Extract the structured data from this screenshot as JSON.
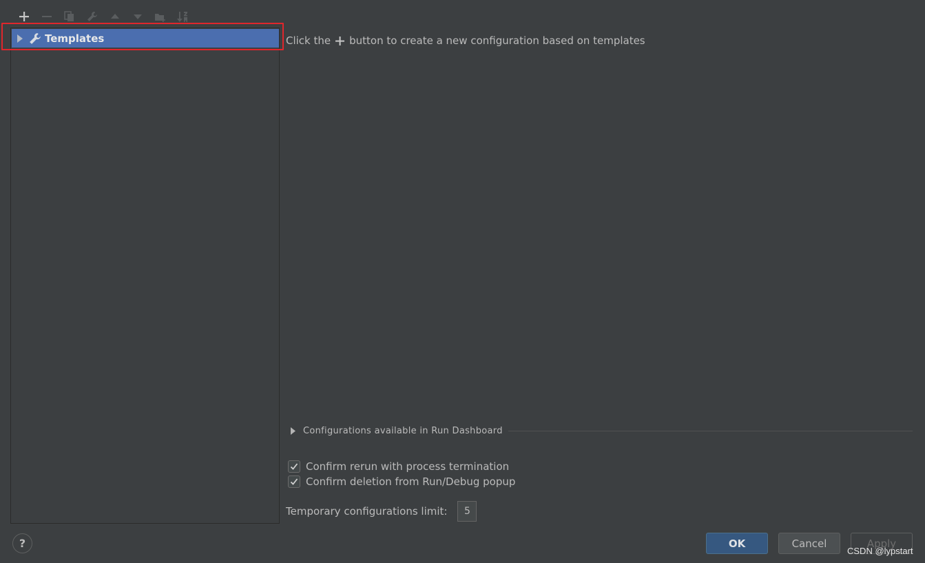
{
  "toolbar": {
    "items": [
      {
        "icon": "add-icon",
        "enabled": true
      },
      {
        "icon": "remove-icon",
        "enabled": false
      },
      {
        "icon": "copy-icon",
        "enabled": false
      },
      {
        "icon": "wrench-icon",
        "enabled": false
      },
      {
        "icon": "move-up-icon",
        "enabled": false
      },
      {
        "icon": "move-down-icon",
        "enabled": false
      },
      {
        "icon": "new-folder-icon",
        "enabled": false
      },
      {
        "icon": "sort-alphabetically-icon",
        "enabled": false
      }
    ]
  },
  "tree": {
    "items": [
      {
        "label": "Templates",
        "icon": "wrench-icon",
        "expanded": false,
        "selected": true
      }
    ],
    "highlight_color": "#e0262c",
    "selection_color": "#4b6eaf"
  },
  "main": {
    "hint_prefix": "Click the",
    "hint_suffix": "button to create a new configuration based on templates",
    "dashboard_label": "Configurations available in Run Dashboard",
    "options": [
      {
        "label": "Confirm rerun with process termination",
        "checked": true
      },
      {
        "label": "Confirm deletion from Run/Debug popup",
        "checked": true
      }
    ],
    "limit_label": "Temporary configurations limit:",
    "limit_value": "5"
  },
  "footer": {
    "help_label": "?",
    "ok_label": "OK",
    "cancel_label": "Cancel",
    "apply_label": "Apply",
    "apply_enabled": false,
    "accent_color": "#365880"
  },
  "watermark": "CSDN @lypstart"
}
